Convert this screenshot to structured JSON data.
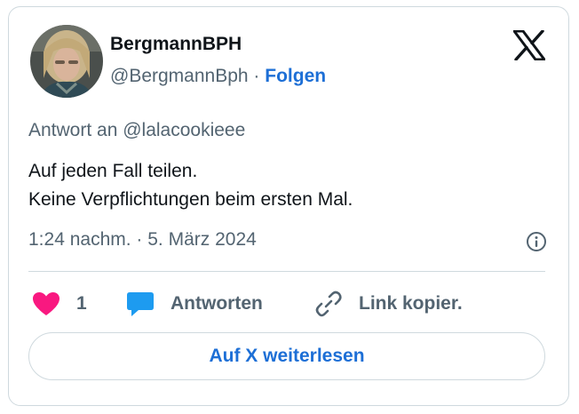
{
  "author": {
    "display_name": "BergmannBPH",
    "handle": "@BergmannBph",
    "separator": "·",
    "follow_label": "Folgen"
  },
  "tweet": {
    "reply_to": "Antwort an @lalacookieee",
    "lines": [
      "Auf jeden Fall teilen.",
      "Keine Verpflichtungen beim ersten Mal."
    ],
    "timestamp": "1:24 nachm. · 5. März 2024"
  },
  "actions": {
    "like_count": "1",
    "reply_label": "Antworten",
    "copy_label": "Link kopier."
  },
  "read_more_label": "Auf X weiterlesen",
  "icons": {
    "brand": "x-logo-icon",
    "info": "info-icon",
    "like": "heart-icon",
    "reply": "speech-bubble-icon",
    "copy": "link-icon"
  },
  "colors": {
    "link_blue": "#1d6fd6",
    "heart_pink": "#f91880",
    "reply_blue": "#1d9bf0",
    "muted_text": "#536471",
    "border": "#cfd9de"
  }
}
